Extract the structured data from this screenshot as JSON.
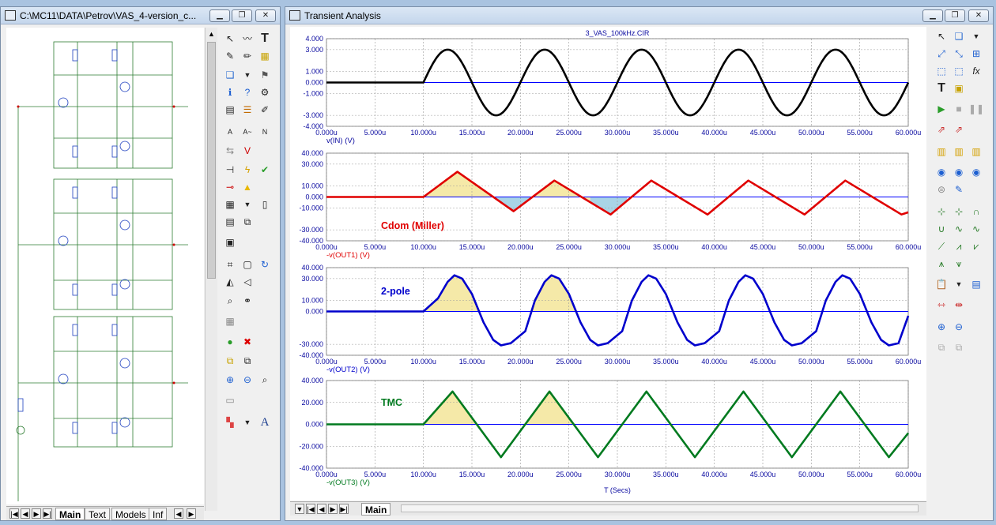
{
  "left_window": {
    "title": "C:\\MC11\\DATA\\Petrov\\VAS_4-version_c...",
    "tabs": [
      "Main",
      "Text",
      "Models",
      "Inf"
    ],
    "active_tab": "Main"
  },
  "right_window": {
    "title": "Transient Analysis",
    "tabs": [
      "Main"
    ],
    "active_tab": "Main"
  },
  "buttons": {
    "minimize": "▁",
    "restore": "❐",
    "close": "✕"
  },
  "chart_data": {
    "title": "3_VAS_100kHz.CIR",
    "xlabel": "T (Secs)",
    "x_ticks": [
      "0.000u",
      "5.000u",
      "10.000u",
      "15.000u",
      "20.000u",
      "25.000u",
      "30.000u",
      "35.000u",
      "40.000u",
      "45.000u",
      "50.000u",
      "55.000u",
      "60.000u"
    ],
    "xlim": [
      0,
      60
    ],
    "grid": true,
    "panels": [
      {
        "type": "line",
        "ylabel": "v(IN) (V)",
        "ylim": [
          -4,
          4
        ],
        "yticks": [
          "4.000",
          "3.000",
          "1.000",
          "0.000",
          "-1.000",
          "-3.000",
          "-4.000"
        ],
        "ytick_values": [
          4,
          3,
          1,
          0,
          -1,
          -3,
          -4
        ],
        "color": "#000000",
        "annotation": "",
        "series": {
          "kind": "sine",
          "start": 10,
          "period": 10,
          "amplitude": 3
        }
      },
      {
        "type": "line",
        "ylabel": "-v(OUT1) (V)",
        "ylim": [
          -40,
          40
        ],
        "yticks": [
          "40.000",
          "30.000",
          "10.000",
          "0.000",
          "-10.000",
          "-30.000",
          "-40.000"
        ],
        "ytick_values": [
          40,
          30,
          10,
          0,
          -10,
          -30,
          -40
        ],
        "color": "#e00000",
        "annotation": "Cdom (Miller)",
        "series": {
          "kind": "points",
          "points": [
            [
              0,
              0
            ],
            [
              10,
              0
            ],
            [
              13.5,
              23
            ],
            [
              19.3,
              -13
            ],
            [
              23.5,
              15
            ],
            [
              29.3,
              -16
            ],
            [
              33.5,
              15
            ],
            [
              39.3,
              -16
            ],
            [
              43.5,
              15
            ],
            [
              49.3,
              -16
            ],
            [
              53.5,
              15
            ],
            [
              59.3,
              -16
            ],
            [
              60,
              -14
            ]
          ]
        },
        "fills": [
          {
            "from": 10,
            "to": 17.2,
            "color": "#f5e9a8"
          },
          {
            "from": 17.2,
            "to": 21.2,
            "color": "#a9d4e6"
          },
          {
            "from": 21.2,
            "to": 27.2,
            "color": "#f5e9a8"
          },
          {
            "from": 27.2,
            "to": 31.0,
            "color": "#a9d4e6"
          }
        ]
      },
      {
        "type": "line",
        "ylabel": "-v(OUT2) (V)",
        "ylim": [
          -40,
          40
        ],
        "yticks": [
          "40.000",
          "30.000",
          "10.000",
          "0.000",
          "-30.000",
          "-40.000"
        ],
        "ytick_values": [
          40,
          30,
          10,
          0,
          -30,
          -40
        ],
        "color": "#0000cc",
        "annotation": "2-pole",
        "series": {
          "kind": "points",
          "points": [
            [
              0,
              0
            ],
            [
              10,
              0
            ],
            [
              11.5,
              12
            ],
            [
              12.5,
              27
            ],
            [
              13.2,
              33
            ],
            [
              14,
              30
            ],
            [
              15,
              16
            ],
            [
              16.2,
              -10
            ],
            [
              17.2,
              -26
            ],
            [
              18,
              -31
            ],
            [
              19,
              -29
            ],
            [
              20.5,
              -18
            ],
            [
              21.5,
              10
            ],
            [
              22.5,
              27
            ],
            [
              23.2,
              33
            ],
            [
              24,
              30
            ],
            [
              25,
              16
            ],
            [
              26.2,
              -10
            ],
            [
              27.2,
              -26
            ],
            [
              28,
              -31
            ],
            [
              29,
              -29
            ],
            [
              30.5,
              -18
            ],
            [
              31.5,
              10
            ],
            [
              32.5,
              27
            ],
            [
              33.2,
              33
            ],
            [
              34,
              30
            ],
            [
              35,
              16
            ],
            [
              36.2,
              -10
            ],
            [
              37.2,
              -26
            ],
            [
              38,
              -31
            ],
            [
              39,
              -29
            ],
            [
              40.5,
              -18
            ],
            [
              41.5,
              10
            ],
            [
              42.5,
              27
            ],
            [
              43.2,
              33
            ],
            [
              44,
              30
            ],
            [
              45,
              16
            ],
            [
              46.2,
              -10
            ],
            [
              47.2,
              -26
            ],
            [
              48,
              -31
            ],
            [
              49,
              -29
            ],
            [
              50.5,
              -18
            ],
            [
              51.5,
              10
            ],
            [
              52.5,
              27
            ],
            [
              53.2,
              33
            ],
            [
              54,
              30
            ],
            [
              55,
              16
            ],
            [
              56.2,
              -10
            ],
            [
              57.2,
              -26
            ],
            [
              58,
              -31
            ],
            [
              59,
              -29
            ],
            [
              60,
              -4
            ]
          ]
        },
        "fills": [
          {
            "from": 10,
            "to": 15.7,
            "color": "#f5e9a8"
          },
          {
            "from": 21.0,
            "to": 25.7,
            "color": "#f5e9a8"
          }
        ]
      },
      {
        "type": "line",
        "ylabel": "-v(OUT3) (V)",
        "ylim": [
          -40,
          40
        ],
        "yticks": [
          "40.000",
          "20.000",
          "0.000",
          "-20.000",
          "-40.000"
        ],
        "ytick_values": [
          40,
          20,
          0,
          -20,
          -40
        ],
        "color": "#007a1f",
        "annotation": "TMC",
        "series": {
          "kind": "points",
          "points": [
            [
              0,
              0
            ],
            [
              10,
              0
            ],
            [
              13,
              30
            ],
            [
              18,
              -30
            ],
            [
              23,
              30
            ],
            [
              28,
              -30
            ],
            [
              33,
              30
            ],
            [
              38,
              -30
            ],
            [
              43,
              30
            ],
            [
              48,
              -30
            ],
            [
              53,
              30
            ],
            [
              58,
              -30
            ],
            [
              60,
              -8
            ]
          ]
        },
        "fills": [
          {
            "from": 10,
            "to": 15.5,
            "color": "#f5e9a8"
          },
          {
            "from": 20.5,
            "to": 25.5,
            "color": "#f5e9a8"
          }
        ]
      }
    ]
  }
}
